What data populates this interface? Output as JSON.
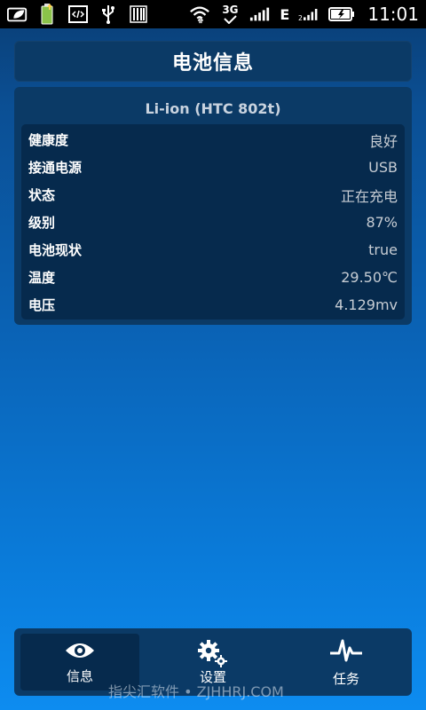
{
  "status_bar": {
    "network_type": "3G",
    "data_type": "E",
    "time": "11:01"
  },
  "header": {
    "title": "电池信息"
  },
  "battery": {
    "model": "Li-ion (HTC 802t)",
    "rows": [
      {
        "label": "健康度",
        "value": "良好"
      },
      {
        "label": "接通电源",
        "value": "USB"
      },
      {
        "label": "状态",
        "value": "正在充电"
      },
      {
        "label": "级别",
        "value": "87%"
      },
      {
        "label": "电池现状",
        "value": "true"
      },
      {
        "label": "温度",
        "value": "29.50℃"
      },
      {
        "label": "电压",
        "value": "4.129mv"
      }
    ]
  },
  "bottom_nav": {
    "items": [
      {
        "label": "信息",
        "icon": "eye-icon",
        "active": true
      },
      {
        "label": "设置",
        "icon": "gears-icon",
        "active": false
      },
      {
        "label": "任务",
        "icon": "pulse-icon",
        "active": false
      }
    ]
  },
  "watermark": "指尖汇软件 • ZJHHRJ.COM"
}
